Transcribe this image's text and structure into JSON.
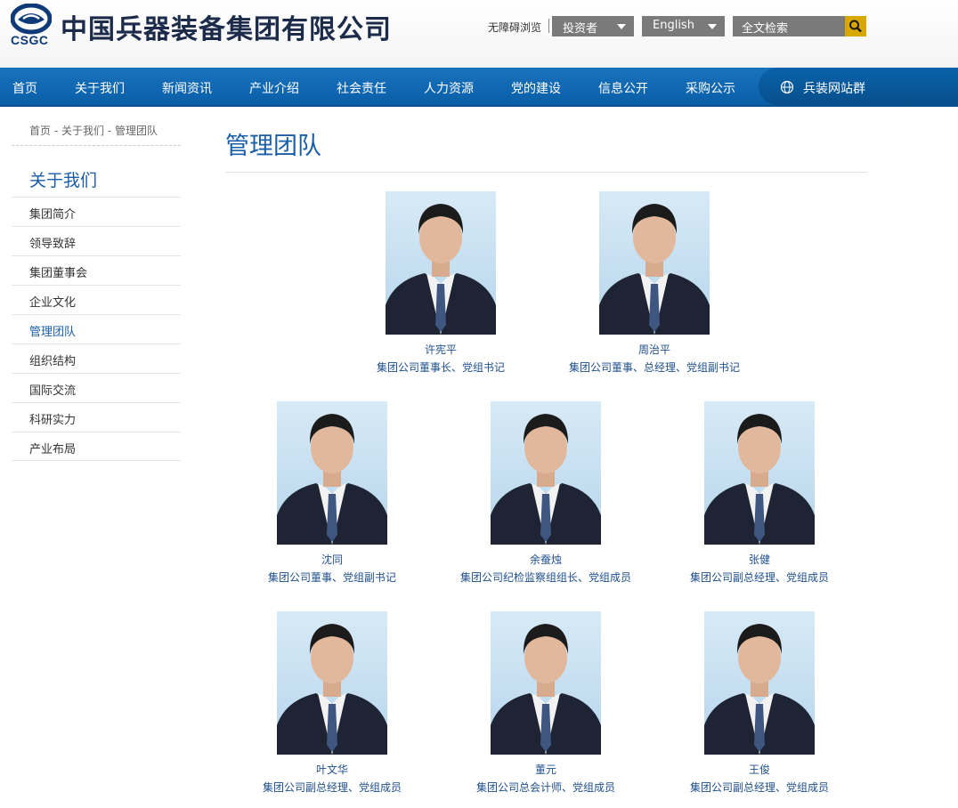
{
  "header": {
    "company_name": "中国兵器装备集团有限公司",
    "logo_text": "CSGC",
    "accessibility_link": "无障碍浏览",
    "investor_dropdown": "投资者",
    "language_dropdown": "English",
    "search_placeholder": "全文检索",
    "search_icon": "search-icon"
  },
  "nav": {
    "items": [
      "首页",
      "关于我们",
      "新闻资讯",
      "产业介绍",
      "社会责任",
      "人力资源",
      "党的建设",
      "信息公开",
      "采购公示"
    ],
    "site_group": "兵装网站群",
    "site_group_icon": "globe-icon"
  },
  "breadcrumb": [
    "首页",
    "关于我们",
    "管理团队"
  ],
  "breadcrumb_separator": "-",
  "sidebar": {
    "title": "关于我们",
    "items": [
      "集团简介",
      "领导致辞",
      "集团董事会",
      "企业文化",
      "管理团队",
      "组织结构",
      "国际交流",
      "科研实力",
      "产业布局"
    ],
    "active_index": 4
  },
  "main": {
    "title": "管理团队",
    "members": [
      {
        "name": "许宪平",
        "role": "集团公司董事长、党组书记"
      },
      {
        "name": "周治平",
        "role": "集团公司董事、总经理、党组副书记"
      },
      {
        "name": "沈同",
        "role": "集团公司董事、党组副书记"
      },
      {
        "name": "余蚕烛",
        "role": "集团公司纪检监察组组长、党组成员"
      },
      {
        "name": "张健",
        "role": "集团公司副总经理、党组成员"
      },
      {
        "name": "叶文华",
        "role": "集团公司副总经理、党组成员"
      },
      {
        "name": "董元",
        "role": "集团公司总会计师、党组成员"
      },
      {
        "name": "王俊",
        "role": "集团公司副总经理、党组成员"
      }
    ]
  },
  "colors": {
    "brand_blue": "#1a5ea8",
    "nav_blue": "#0a5ea8",
    "search_button": "#d8a800",
    "dropdown_gray": "#7a7a7a"
  }
}
